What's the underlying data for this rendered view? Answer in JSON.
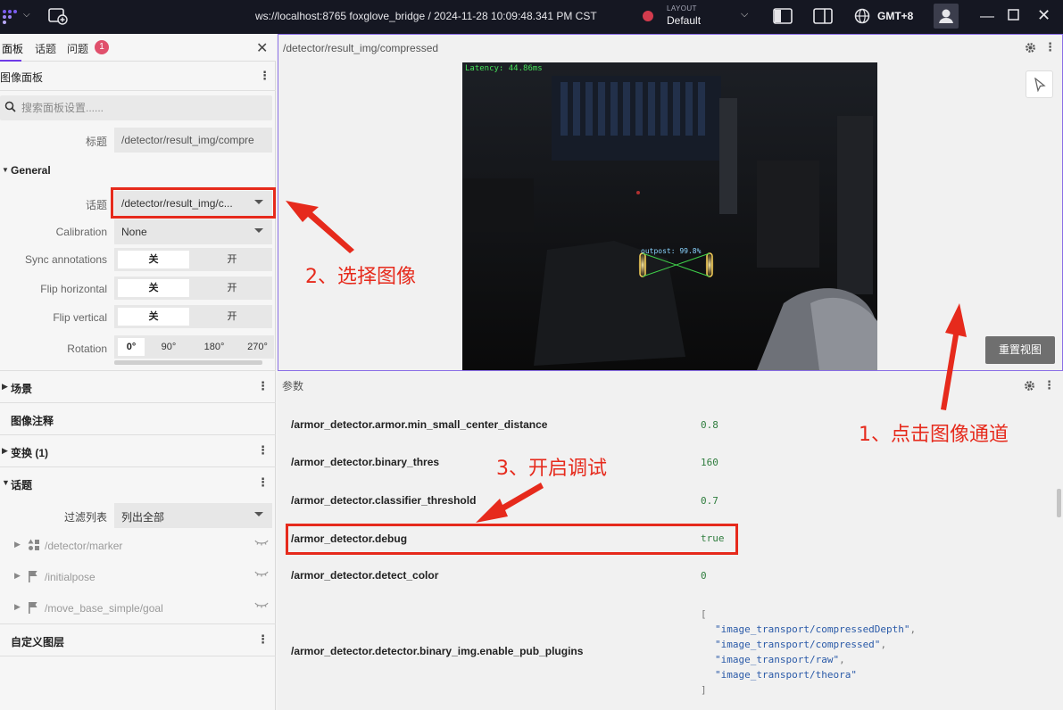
{
  "titlebar": {
    "connection_title": "ws://localhost:8765 foxglove_bridge / 2024-11-28 10:09:48.341 PM CST",
    "layout_caption": "LAYOUT",
    "layout_name": "Default",
    "timezone": "GMT+8"
  },
  "left_panel": {
    "tabs": [
      {
        "label": "面板"
      },
      {
        "label": "话题"
      },
      {
        "label": "问题",
        "badge": "1"
      }
    ],
    "panel_name": "图像面板",
    "search_placeholder": "搜索面板设置......",
    "settings": {
      "title_label": "标题",
      "title_value": "/detector/result_img/compre",
      "general_label": "General",
      "topic_label": "话题",
      "topic_value": "/detector/result_img/c...",
      "calibration_label": "Calibration",
      "calibration_value": "None",
      "sync_label": "Sync annotations",
      "flip_h_label": "Flip horizontal",
      "flip_v_label": "Flip vertical",
      "off": "关",
      "on": "开",
      "rotation_label": "Rotation",
      "rotation_options": [
        "0°",
        "90°",
        "180°",
        "270°"
      ]
    },
    "sections": {
      "scene": "场景",
      "image_annotations": "图像注释",
      "transforms": "变换 (1)",
      "topics": "话题",
      "custom_layers": "自定义图层"
    },
    "filter_label": "过滤列表",
    "filter_value": "列出全部",
    "topic_items": [
      {
        "label": "/detector/marker",
        "icon": "shapes-icon"
      },
      {
        "label": "/initialpose",
        "icon": "flag-icon"
      },
      {
        "label": "/move_base_simple/goal",
        "icon": "flag-icon"
      }
    ]
  },
  "image_panel": {
    "topic": "/detector/result_img/compressed",
    "latency_text": "Latency: 44.86ms",
    "detection_label": "outpost: 99.8%",
    "reset_view_label": "重置视图"
  },
  "params_panel": {
    "title": "参数",
    "rows": [
      {
        "key": "/armor_detector.armor.min_small_center_distance",
        "value": "0.8"
      },
      {
        "key": "/armor_detector.binary_thres",
        "value": "160"
      },
      {
        "key": "/armor_detector.classifier_threshold",
        "value": "0.7"
      },
      {
        "key": "/armor_detector.debug",
        "value": "true"
      },
      {
        "key": "/armor_detector.detect_color",
        "value": "0"
      },
      {
        "key": "/armor_detector.detector.binary_img.enable_pub_plugins",
        "value": ""
      }
    ],
    "plugin_list_open": "[",
    "plugin_list": [
      "\"image_transport/compressedDepth\"",
      "\"image_transport/compressed\"",
      "\"image_transport/raw\"",
      "\"image_transport/theora\""
    ],
    "plugin_list_close": "]"
  },
  "annotations": {
    "step1": "1、点击图像通道",
    "step2": "2、选择图像",
    "step3": "3、开启调试",
    "color": "#e62a1c"
  }
}
